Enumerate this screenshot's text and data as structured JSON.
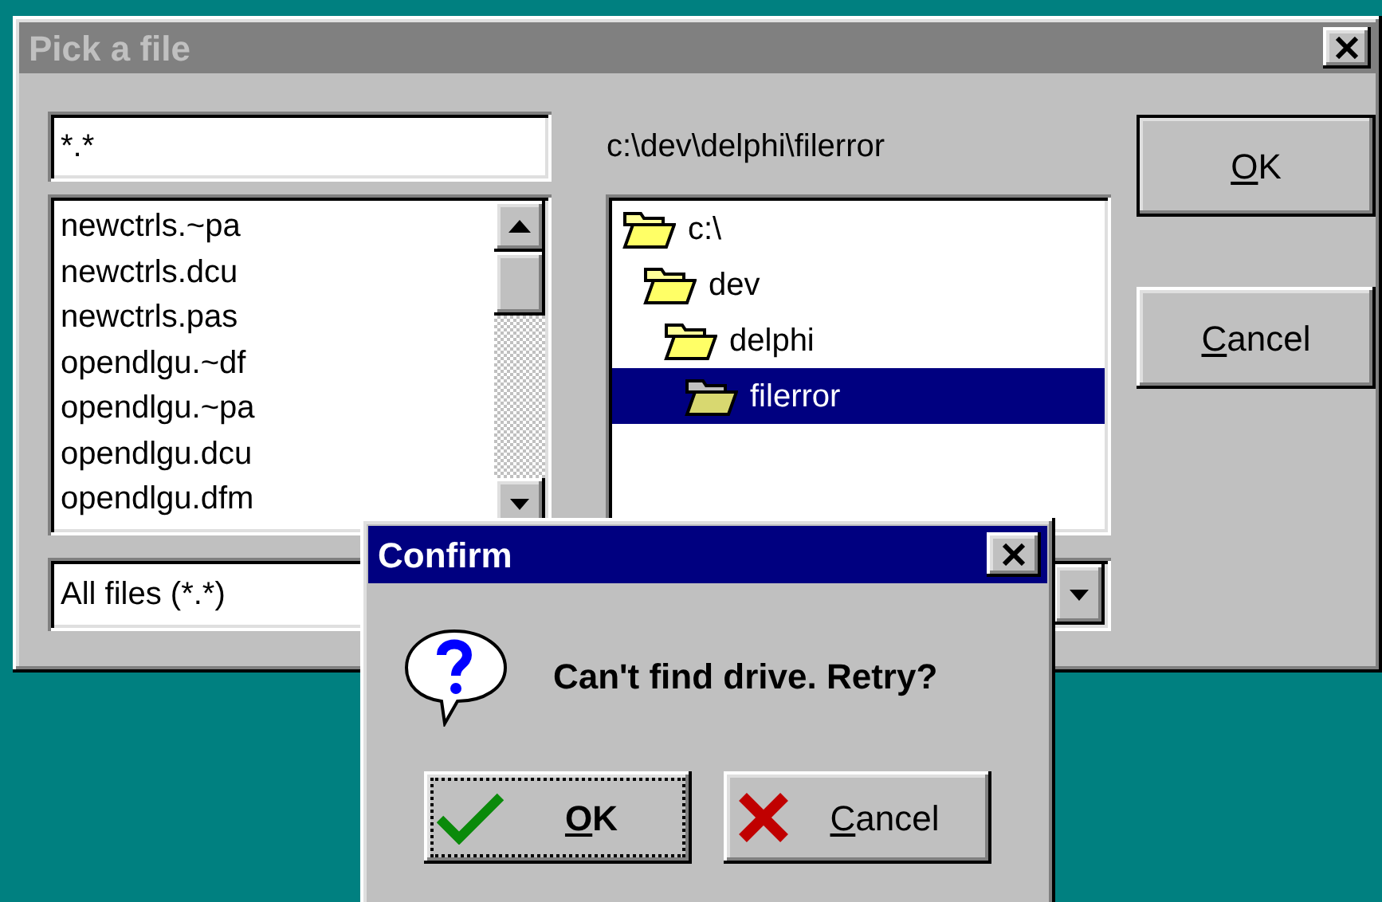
{
  "window": {
    "title": "Pick a file",
    "active": false
  },
  "filename_field": {
    "value": "*.*"
  },
  "files": [
    "newctrls.~pa",
    "newctrls.dcu",
    "newctrls.pas",
    "opendlgu.~df",
    "opendlgu.~pa",
    "opendlgu.dcu",
    "opendlgu.dfm"
  ],
  "filter_combo": {
    "value": "All files (*.*)"
  },
  "current_path": "c:\\dev\\delphi\\filerror",
  "folder_tree": [
    {
      "label": "c:\\",
      "selected": false,
      "children": [
        {
          "label": "dev",
          "selected": false,
          "children": [
            {
              "label": "delphi",
              "selected": false,
              "children": [
                {
                  "label": "filerror",
                  "selected": true
                }
              ]
            }
          ]
        }
      ]
    }
  ],
  "buttons": [
    {
      "label": "OK",
      "default": true,
      "mnemonic_underlined": true
    },
    {
      "label": "Cancel",
      "default": false,
      "mnemonic_underlined": true
    }
  ],
  "confirm_dialog": {
    "title": "Confirm",
    "active": true,
    "message": "Can't find drive. Retry?",
    "buttons": [
      {
        "kind": "ok",
        "label": "OK",
        "focused": true,
        "mnemonic_underlined": true
      },
      {
        "kind": "cancel",
        "label": "Cancel",
        "focused": false,
        "mnemonic_underlined": true
      }
    ]
  }
}
